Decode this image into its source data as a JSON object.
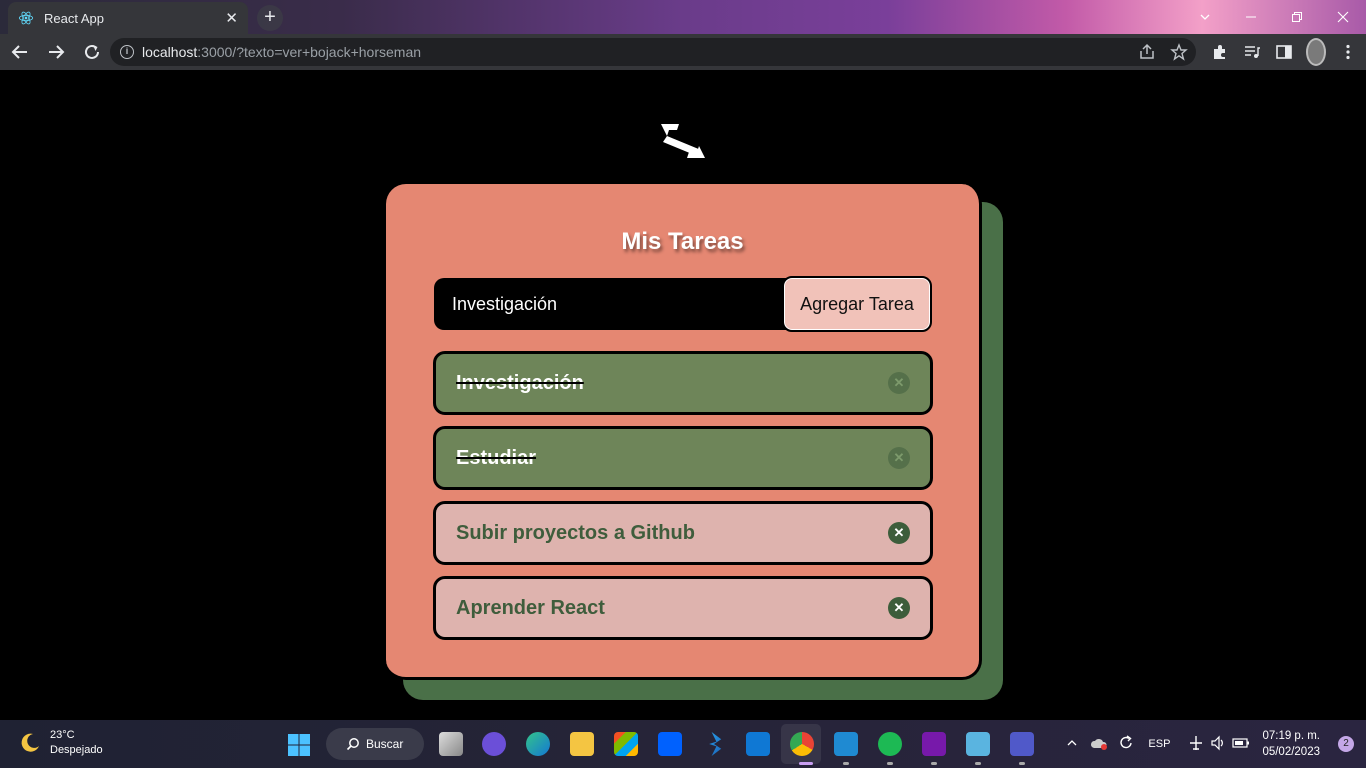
{
  "browser": {
    "tab_title": "React App",
    "tab_close": "✕",
    "new_tab": "+",
    "url_host": "localhost",
    "url_rest": ":3000/?texto=ver+bojack+horseman"
  },
  "app": {
    "title": "Mis Tareas",
    "input": {
      "value": "Investigación"
    },
    "add_button": "Agregar Tarea",
    "tasks": [
      {
        "text": "Investigación",
        "completed": true
      },
      {
        "text": "Estudiar",
        "completed": true
      },
      {
        "text": "Subir proyectos a Github",
        "completed": false
      },
      {
        "text": "Aprender React",
        "completed": false
      }
    ],
    "delete_symbol": "✕"
  },
  "colors": {
    "card": "#e58772",
    "card_shadow": "#4a7048",
    "task_done": "#6e8559",
    "task_pending": "#deb3ae",
    "button": "#f1c2b9"
  },
  "taskbar": {
    "temperature": "23°C",
    "weather": "Despejado",
    "search": "Buscar",
    "language": "ESP",
    "time": "07:19 p. m.",
    "date": "05/02/2023",
    "notifications": "2"
  }
}
